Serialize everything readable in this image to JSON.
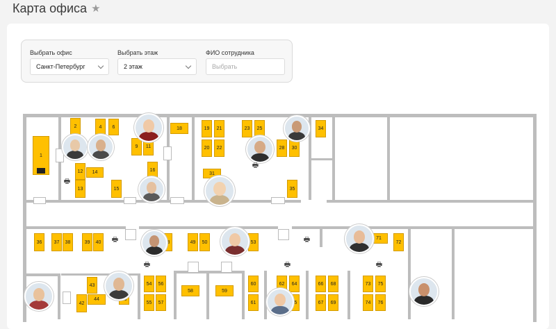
{
  "page": {
    "title": "Карта офиса",
    "star_icon": "star-icon"
  },
  "filters": {
    "office": {
      "label": "Выбрать офис",
      "value": "Санкт-Петербург"
    },
    "floor": {
      "label": "Выбрать этаж",
      "value": "2 этаж"
    },
    "employee": {
      "label": "ФИО сотрудника",
      "placeholder": "Выбрать"
    }
  },
  "desks": [
    "1",
    "2",
    "4",
    "6",
    "9",
    "11",
    "12",
    "14",
    "13",
    "15",
    "16",
    "18",
    "19",
    "21",
    "20",
    "22",
    "23",
    "25",
    "28",
    "30",
    "31",
    "34",
    "35",
    "36",
    "37",
    "38",
    "39",
    "40",
    "48",
    "49",
    "50",
    "53",
    "71",
    "72",
    "43",
    "42",
    "44",
    "46",
    "54",
    "56",
    "55",
    "57",
    "58",
    "59",
    "60",
    "61",
    "62",
    "64",
    "65",
    "66",
    "68",
    "67",
    "69",
    "73",
    "75",
    "74",
    "76"
  ],
  "colors": {
    "desk": "#ffc000",
    "wall": "#bdbdbd",
    "background": "#f3f3f3"
  }
}
